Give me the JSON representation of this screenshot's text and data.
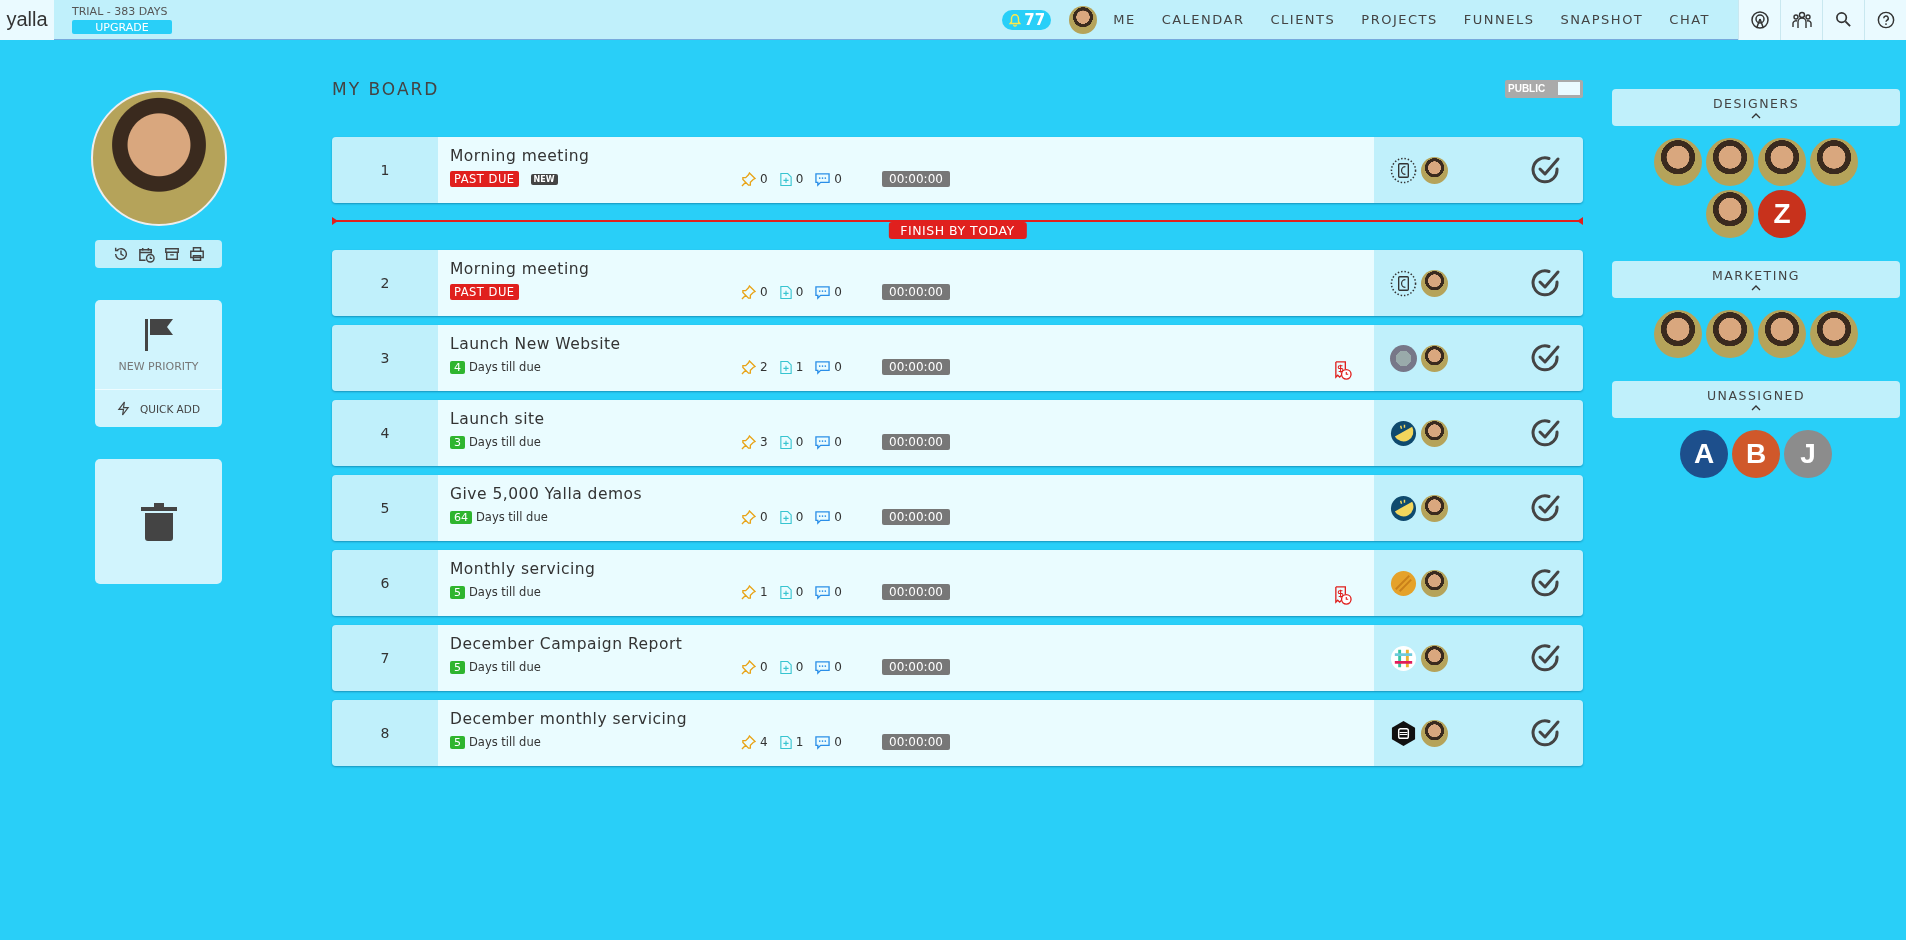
{
  "topbar": {
    "logo": "yalla",
    "trial": "TRIAL - 383 DAYS",
    "upgrade": "UPGRADE",
    "notifications": "77",
    "nav": [
      {
        "label": "ME",
        "kind": "profile",
        "selected": false
      },
      {
        "label": "CALENDAR",
        "kind": "link",
        "selected": false
      },
      {
        "label": "CLIENTS",
        "kind": "link",
        "selected": false
      },
      {
        "label": "PROJECTS",
        "kind": "link",
        "selected": false
      },
      {
        "label": "FUNNELS",
        "kind": "link",
        "selected": false
      },
      {
        "label": "SNAPSHOT",
        "kind": "link",
        "selected": false
      },
      {
        "label": "CHAT",
        "kind": "link",
        "selected": false
      }
    ]
  },
  "sidebar": {
    "new_priority": "NEW PRIORITY",
    "quick_add": "QUICK ADD"
  },
  "board": {
    "title": "MY BOARD",
    "toggle": {
      "label": "PUBLIC",
      "on": true
    },
    "items": [
      {
        "kind": "task",
        "number": "1",
        "title": "Morning meeting",
        "due": {
          "kind": "past_due",
          "label": "PAST DUE"
        },
        "new_badge": "NEW",
        "pins": "0",
        "files": "0",
        "comments": "0",
        "timer": "00:00:00",
        "billing_alert": false,
        "client": {
          "kind": "notebook"
        }
      },
      {
        "kind": "divider",
        "label": "FINISH BY TODAY"
      },
      {
        "kind": "task",
        "number": "2",
        "title": "Morning meeting",
        "due": {
          "kind": "past_due",
          "label": "PAST DUE"
        },
        "pins": "0",
        "files": "0",
        "comments": "0",
        "timer": "00:00:00",
        "billing_alert": false,
        "client": {
          "kind": "notebook"
        }
      },
      {
        "kind": "task",
        "number": "3",
        "title": "Launch New Website",
        "due": {
          "kind": "days",
          "count": "4",
          "label": "Days till due"
        },
        "pins": "2",
        "files": "1",
        "comments": "0",
        "timer": "00:00:00",
        "billing_alert": true,
        "client": {
          "kind": "photo"
        }
      },
      {
        "kind": "task",
        "number": "4",
        "title": "Launch site",
        "due": {
          "kind": "days",
          "count": "3",
          "label": "Days till due"
        },
        "pins": "3",
        "files": "0",
        "comments": "0",
        "timer": "00:00:00",
        "billing_alert": false,
        "client": {
          "kind": "lemon"
        }
      },
      {
        "kind": "task",
        "number": "5",
        "title": "Give 5,000 Yalla demos",
        "due": {
          "kind": "days",
          "count": "64",
          "label": "Days till due"
        },
        "pins": "0",
        "files": "0",
        "comments": "0",
        "timer": "00:00:00",
        "billing_alert": false,
        "client": {
          "kind": "lemon"
        }
      },
      {
        "kind": "task",
        "number": "6",
        "title": "Monthly servicing",
        "due": {
          "kind": "days",
          "count": "5",
          "label": "Days till due"
        },
        "pins": "1",
        "files": "0",
        "comments": "0",
        "timer": "00:00:00",
        "billing_alert": true,
        "client": {
          "kind": "striped"
        }
      },
      {
        "kind": "task",
        "number": "7",
        "title": "December Campaign Report",
        "due": {
          "kind": "days",
          "count": "5",
          "label": "Days till due"
        },
        "pins": "0",
        "files": "0",
        "comments": "0",
        "timer": "00:00:00",
        "billing_alert": false,
        "client": {
          "kind": "hash"
        }
      },
      {
        "kind": "task",
        "number": "8",
        "title": "December monthly servicing",
        "due": {
          "kind": "days",
          "count": "5",
          "label": "Days till due"
        },
        "pins": "4",
        "files": "1",
        "comments": "0",
        "timer": "00:00:00",
        "billing_alert": false,
        "client": {
          "kind": "hexagon"
        }
      }
    ]
  },
  "groups": [
    {
      "name": "DESIGNERS",
      "expanded": true,
      "members": [
        {
          "kind": "photo"
        },
        {
          "kind": "photo"
        },
        {
          "kind": "photo"
        },
        {
          "kind": "photo"
        },
        {
          "kind": "photo"
        },
        {
          "kind": "letter",
          "letter": "Z",
          "color": "#c8321c"
        }
      ]
    },
    {
      "name": "MARKETING",
      "expanded": true,
      "members": [
        {
          "kind": "photo"
        },
        {
          "kind": "photo"
        },
        {
          "kind": "photo"
        },
        {
          "kind": "photo"
        }
      ]
    },
    {
      "name": "UNASSIGNED",
      "expanded": true,
      "members": [
        {
          "kind": "letter",
          "letter": "A",
          "color": "#1d4f8c"
        },
        {
          "kind": "letter",
          "letter": "B",
          "color": "#d0582a"
        },
        {
          "kind": "letter",
          "letter": "J",
          "color": "#8c8c8c"
        }
      ]
    }
  ]
}
